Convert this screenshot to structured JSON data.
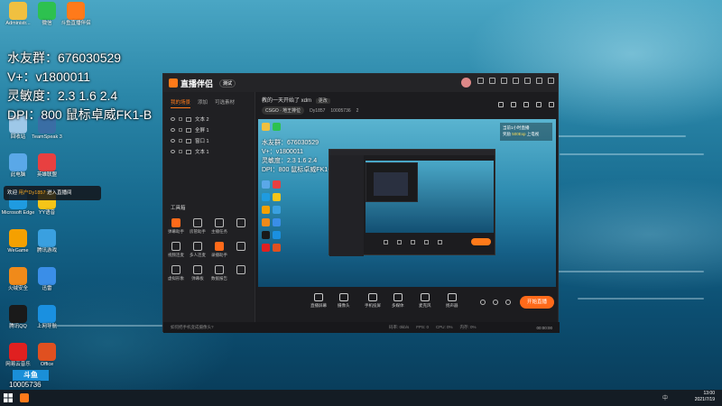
{
  "overlay": {
    "line1": "水友群：676030529",
    "line2": "V+：v1800011",
    "line3": "灵敏度：2.3   1.6  2.4",
    "line4": "DPI：800  鼠标卓威FK1-B"
  },
  "chat": {
    "prefix": "欢迎",
    "user": "用户Dy1857",
    "suffix": "进入直播间"
  },
  "room": {
    "badge": "斗鱼",
    "number": "10005736"
  },
  "desktop_icons": [
    {
      "label": "Administr...",
      "icon": "user-folder-icon",
      "color": "#f0c040"
    },
    {
      "label": "微信",
      "icon": "wechat-icon",
      "color": "#2dc14f"
    },
    {
      "label": "斗鱼直播伴侣",
      "icon": "douyu-companion-icon",
      "color": "#ff7a1a"
    },
    {
      "label": "回收站",
      "icon": "recycle-bin-icon",
      "color": "#9ec8e8"
    },
    {
      "label": "TeamSpeak 3",
      "icon": "teamspeak-icon",
      "color": "#3a6ea5"
    },
    {
      "label": "此电脑",
      "icon": "computer-icon",
      "color": "#5aa8e8"
    },
    {
      "label": "英雄联盟",
      "icon": "game-icon",
      "color": "#e84040"
    },
    {
      "label": "Microsoft Edge",
      "icon": "edge-icon",
      "color": "#1f9be0"
    },
    {
      "label": "YY语音",
      "icon": "yy-icon",
      "color": "#f5c518"
    },
    {
      "label": "WeGame",
      "icon": "wegame-icon",
      "color": "#f5a000"
    },
    {
      "label": "腾讯游戏",
      "icon": "tencent-game-icon",
      "color": "#3aa0e0"
    },
    {
      "label": "火绒安全",
      "icon": "security-icon",
      "color": "#f08a1a"
    },
    {
      "label": "迅雷",
      "icon": "thunder-icon",
      "color": "#3a8ee8"
    },
    {
      "label": "腾讯QQ",
      "icon": "qq-icon",
      "color": "#1a1a1a"
    },
    {
      "label": "上网导航",
      "icon": "ie-icon",
      "color": "#1a90e0"
    },
    {
      "label": "网易云音乐",
      "icon": "music-icon",
      "color": "#e02020"
    },
    {
      "label": "Office",
      "icon": "office-icon",
      "color": "#e05020"
    }
  ],
  "taskbar": {
    "time": "13:00",
    "date": "2021/7/19",
    "sys_text": "中"
  },
  "app": {
    "brand": "直播伴侣",
    "version": "测试",
    "left_tabs": [
      "我的场景",
      "添加",
      "可选素材"
    ],
    "scenes": [
      "文本 2",
      "全屏 1",
      "窗口 1",
      "文本 1"
    ],
    "tools_title": "工具箱",
    "tools": [
      {
        "label": "弹幕助手",
        "hot": true
      },
      {
        "label": "房管助手",
        "hot": false
      },
      {
        "label": "主播任务",
        "hot": false
      },
      {
        "label": "",
        "hot": false
      },
      {
        "label": "视频连麦",
        "hot": false
      },
      {
        "label": "多人连麦",
        "hot": false
      },
      {
        "label": "录播助手",
        "hot": true
      },
      {
        "label": "",
        "hot": false
      },
      {
        "label": "虚拟形象",
        "hot": false
      },
      {
        "label": "弹幕板",
        "hot": false
      },
      {
        "label": "数据报告",
        "hot": false
      },
      {
        "label": "",
        "hot": false
      }
    ],
    "room_title": "教的一天开始了 xdm",
    "room_tag": "更改",
    "category": "CSGO · 地王排位",
    "uid_label": "Dy1857",
    "room_id": "10005736",
    "viewers": "2",
    "preview_note_line1": "当前1小时直播",
    "preview_note_line2": "奖励",
    "preview_note_amt": "500Exp",
    "preview_note_line3": "上电视",
    "bottom_tools": [
      "直播屏幕",
      "摄像头",
      "手机投屏",
      "多媒体",
      "麦克风",
      "扬声器"
    ],
    "start_label": "开始直播",
    "cam_hint": "如何把手机变成摄像头?",
    "stats": [
      "码率: 0kb/s",
      "FPS: 0",
      "CPU: 0%",
      "内存: 0%"
    ],
    "live_time": "00:00:00"
  }
}
